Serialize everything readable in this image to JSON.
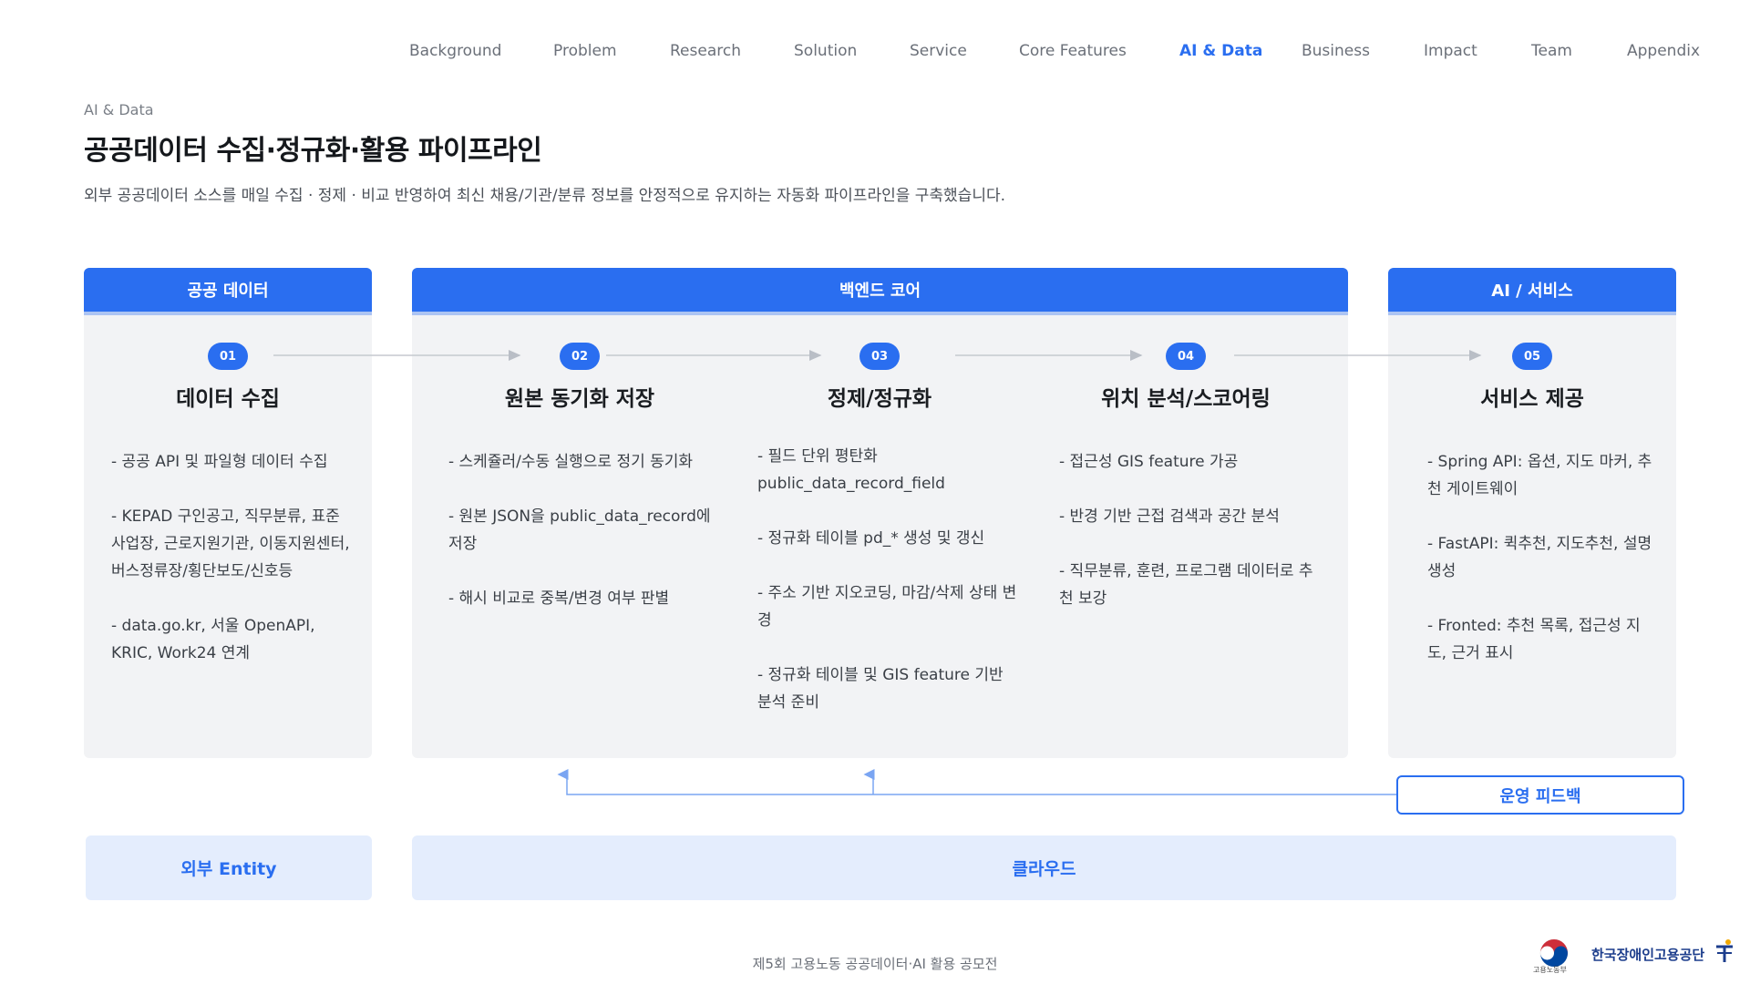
{
  "nav": {
    "items": [
      "Background",
      "Problem",
      "Research",
      "Solution",
      "Service",
      "Core Features",
      "AI & Data",
      "Business",
      "Impact",
      "Team",
      "Appendix"
    ],
    "active": "AI & Data"
  },
  "header": {
    "eyebrow": "AI & Data",
    "title": "공공데이터 수집·정규화·활용 파이프라인",
    "subtitle": "외부 공공데이터 소스를 매일 수집 · 정제 · 비교 반영하여 최신 채용/기관/분류 정보를 안정적으로 유지하는 자동화 파이프라인을 구축했습니다."
  },
  "columns": {
    "public": "공공 데이터",
    "backend": "백엔드 코어",
    "ai": "AI / 서비스"
  },
  "steps": [
    {
      "num": "01",
      "title": "데이터 수집",
      "bullets": [
        "- 공공 API 및 파일형 데이터 수집",
        "- KEPAD 구인공고, 직무분류, 표준 사업장, 근로지원기관, 이동지원센터, 버스정류장/횡단보도/신호등",
        "- data.go.kr, 서울 OpenAPI, KRIC, Work24 연계"
      ]
    },
    {
      "num": "02",
      "title": "원본 동기화 저장",
      "bullets": [
        "- 스케쥴러/수동 실행으로 정기 동기화",
        "- 원본 JSON을 public_data_record에 저장",
        "- 해시 비교로 중복/변경 여부 판별"
      ]
    },
    {
      "num": "03",
      "title": "정제/정규화",
      "bullets": [
        "- 필드 단위 평탄화 public_data_record_field",
        "- 정규화 테이블 pd_* 생성 및 갱신",
        "- 주소 기반 지오코딩, 마감/삭제 상태 변경",
        "- 정규화 테이블 및 GIS feature 기반 분석 준비"
      ]
    },
    {
      "num": "04",
      "title": "위치 분석/스코어링",
      "bullets": [
        "- 접근성 GIS feature 가공",
        "- 반경 기반 근접 검색과 공간 분석",
        "- 직무분류, 훈련, 프로그램 데이터로 추천 보강"
      ]
    },
    {
      "num": "05",
      "title": "서비스 제공",
      "bullets": [
        "- Spring API: 옵션, 지도 마커, 추천 게이트웨이",
        "- FastAPI: 퀵추천, 지도추천, 설명생성",
        "- Fronted: 추천 목록, 접근성 지도, 근거 표시"
      ]
    }
  ],
  "feedback": "운영 피드백",
  "bottom": {
    "external": "외부 Entity",
    "cloud": "클라우드"
  },
  "footer": "제5회 고용노동 공공데이터·AI 활용 공모전",
  "logos": {
    "ministry": "고용노동부",
    "agency": "한국장애인고용공단"
  },
  "colors": {
    "accent": "#2a6ef0",
    "panel": "#f2f3f5",
    "bottom_panel": "#e4edfd"
  }
}
